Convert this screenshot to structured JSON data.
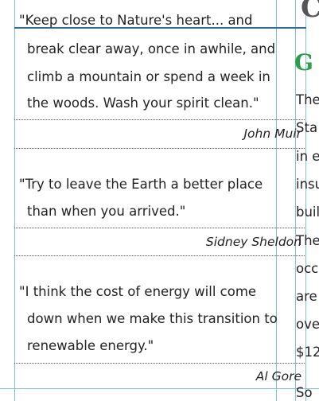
{
  "quotes": [
    {
      "lines": [
        "\"Keep close to Nature's heart... and",
        "break clear away, once in awhile, and",
        "climb a mountain or spend a week in",
        "the woods. Wash your spirit clean.\""
      ],
      "author": "John Muir"
    },
    {
      "lines": [
        "\"Try to leave the Earth a better place",
        "than when you arrived.\""
      ],
      "author": "Sidney Sheldon"
    },
    {
      "lines": [
        "\"I think the cost of energy will come",
        "down when we make this transition to",
        "renewable energy.\""
      ],
      "author": "Al Gore"
    }
  ],
  "right_column": {
    "heading_fragment": "C",
    "subheading_fragment": "G",
    "body_fragments": [
      "The",
      "Sta",
      "in e",
      "insu",
      "buil",
      "The",
      "occ",
      "are",
      "ove",
      "$12",
      "So"
    ]
  },
  "colors": {
    "guide": "#7fc3cf",
    "rule": "#2f6d8f",
    "subheading": "#2e9d4b"
  }
}
